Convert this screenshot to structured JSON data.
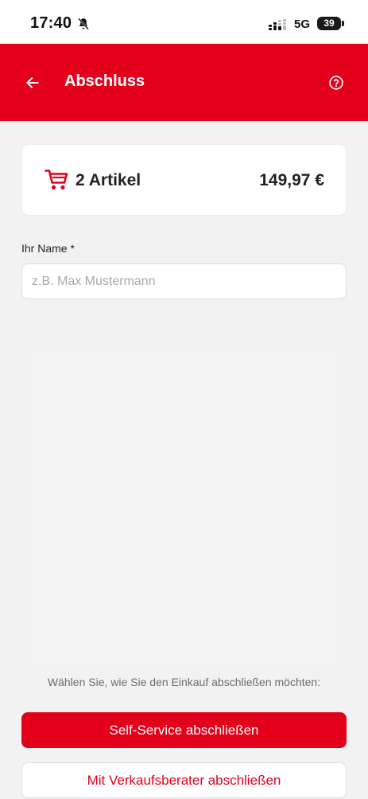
{
  "status_bar": {
    "time": "17:40",
    "network": "5G",
    "battery": "39",
    "icons": [
      "bell-off-icon",
      "signal-icon",
      "battery-icon"
    ]
  },
  "header": {
    "title": "Abschluss",
    "back_icon": "arrow-left-icon",
    "help_icon": "help-circle-icon",
    "background_color": "#e3001b"
  },
  "cart": {
    "icon": "cart-icon",
    "count_label": "2 Artikel",
    "total": "149,97 €"
  },
  "form": {
    "name_label": "Ihr Name *",
    "name_placeholder": "z.B. Max Mustermann",
    "name_value": ""
  },
  "checkout": {
    "hint": "Wählen Sie, wie Sie den Einkauf abschließen möchten:",
    "self_service_label": "Self-Service abschließen",
    "advisor_label": "Mit Verkaufsberater abschließen"
  },
  "colors": {
    "accent": "#e3001b",
    "background": "#f2f2f3",
    "card": "#ffffff"
  }
}
